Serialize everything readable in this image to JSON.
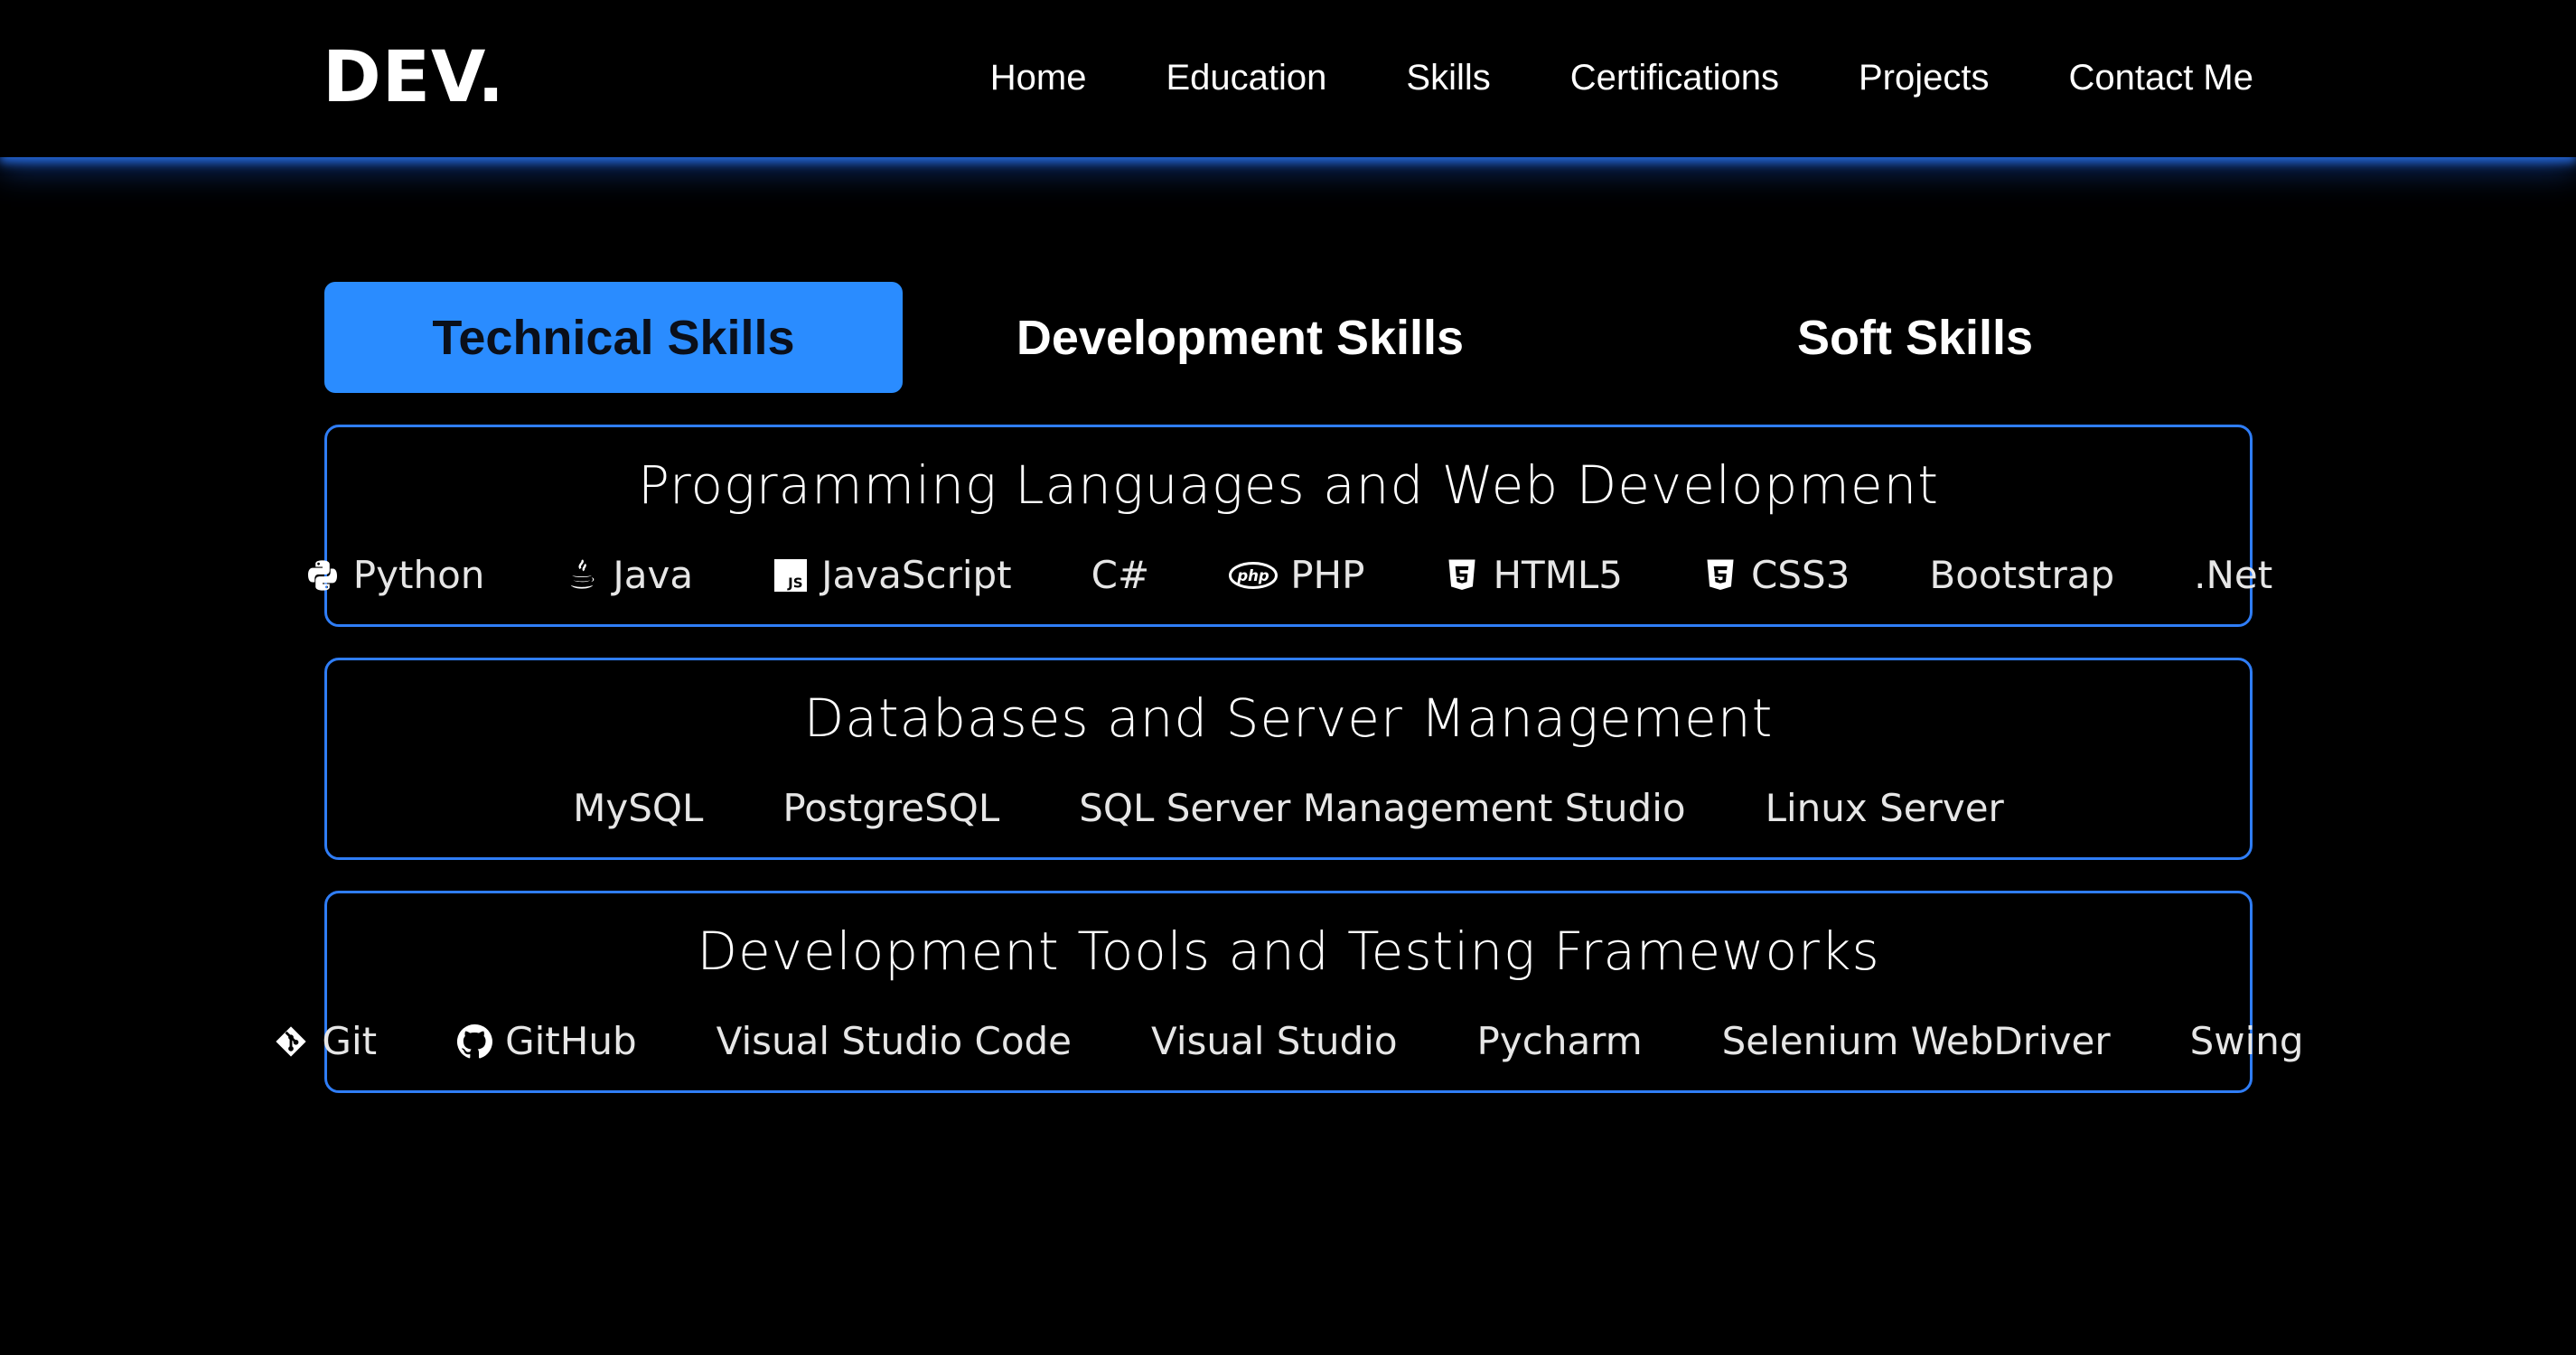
{
  "header": {
    "logo": "DEV.",
    "nav": [
      "Home",
      "Education",
      "Skills",
      "Certifications",
      "Projects",
      "Contact Me"
    ]
  },
  "tabs": [
    "Technical Skills",
    "Development Skills",
    "Soft Skills"
  ],
  "active_tab": "Technical Skills",
  "accent_color": "#2a8cff",
  "border_color": "#2f7df6",
  "sections": [
    {
      "title": "Programming Languages and Web Development",
      "items": [
        {
          "label": "Python",
          "icon": "python-icon"
        },
        {
          "label": "Java",
          "icon": "java-icon"
        },
        {
          "label": "JavaScript",
          "icon": "javascript-icon"
        },
        {
          "label": "C#",
          "icon": ""
        },
        {
          "label": "PHP",
          "icon": "php-icon"
        },
        {
          "label": "HTML5",
          "icon": "html5-icon"
        },
        {
          "label": "CSS3",
          "icon": "css3-icon"
        },
        {
          "label": "Bootstrap",
          "icon": ""
        },
        {
          "label": ".Net",
          "icon": ""
        }
      ]
    },
    {
      "title": "Databases and Server Management",
      "items": [
        {
          "label": "MySQL",
          "icon": ""
        },
        {
          "label": "PostgreSQL",
          "icon": ""
        },
        {
          "label": "SQL Server Management Studio",
          "icon": ""
        },
        {
          "label": "Linux Server",
          "icon": ""
        }
      ]
    },
    {
      "title": "Development Tools and Testing Frameworks",
      "items": [
        {
          "label": "Git",
          "icon": "git-icon"
        },
        {
          "label": "GitHub",
          "icon": "github-icon"
        },
        {
          "label": "Visual Studio Code",
          "icon": ""
        },
        {
          "label": "Visual Studio",
          "icon": ""
        },
        {
          "label": "Pycharm",
          "icon": ""
        },
        {
          "label": "Selenium WebDriver",
          "icon": ""
        },
        {
          "label": "Swing",
          "icon": ""
        }
      ]
    }
  ]
}
